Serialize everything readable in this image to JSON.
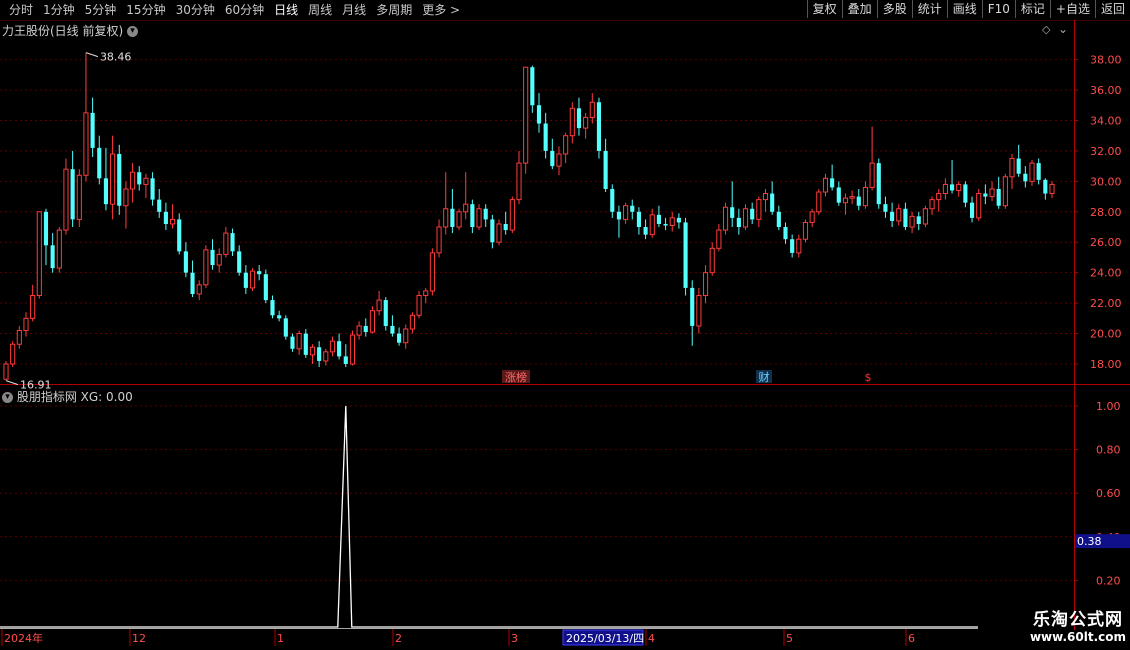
{
  "toolbar": {
    "periods": [
      "分时",
      "1分钟",
      "5分钟",
      "15分钟",
      "30分钟",
      "60分钟",
      "日线",
      "周线",
      "月线",
      "多周期",
      "更多"
    ],
    "active_period": "日线",
    "more_arrow": ">",
    "buttons": [
      "复权",
      "叠加",
      "多股",
      "统计",
      "画线",
      "F10",
      "标记",
      "+自选",
      "返回"
    ]
  },
  "main_chart": {
    "title": "力王股份(日线 前复权)",
    "max_marker": "38.46",
    "min_marker": "16.91",
    "y_ticks": [
      "38.00",
      "36.00",
      "34.00",
      "32.00",
      "30.00",
      "28.00",
      "26.00",
      "24.00",
      "22.00",
      "20.00",
      "18.00"
    ],
    "events": [
      {
        "label": "涨榜",
        "color": "#ff6a6a",
        "bg": "#5a1a1a"
      },
      {
        "label": "财",
        "color": "#6fd3ff",
        "bg": "#103050"
      },
      {
        "label": "$",
        "color": "#ff3030",
        "bg": "#000000"
      }
    ]
  },
  "indicator": {
    "title": "股朋指标网 XG: 0.00",
    "y_ticks": [
      "1.00",
      "0.80",
      "0.60",
      "0.40",
      "0.20"
    ],
    "current_value": "0.38"
  },
  "time_axis": {
    "labels": [
      "2024年",
      "12",
      "1",
      "2",
      "3",
      "4",
      "5",
      "6"
    ],
    "highlight": "2025/03/13/四"
  },
  "watermark": {
    "line1": "乐淘公式网",
    "line2": "www.60lt.com"
  },
  "colors": {
    "up": "#ff3b3b",
    "down": "#54ffff",
    "grid": "#5a0000",
    "axis": "#b00000"
  },
  "chart_data": {
    "type": "candlestick",
    "ylim": [
      16.5,
      39.5
    ],
    "ohlc": [
      [
        17.0,
        18.2,
        16.91,
        18.0
      ],
      [
        18.0,
        19.5,
        17.8,
        19.3
      ],
      [
        19.3,
        20.5,
        19.0,
        20.2
      ],
      [
        20.2,
        21.4,
        19.8,
        21.0
      ],
      [
        21.0,
        23.2,
        20.8,
        22.5
      ],
      [
        22.5,
        28.0,
        22.3,
        28.0
      ],
      [
        28.0,
        28.2,
        24.5,
        25.8
      ],
      [
        25.8,
        26.6,
        24.0,
        24.3
      ],
      [
        24.3,
        27.0,
        24.0,
        26.8
      ],
      [
        26.8,
        31.5,
        26.5,
        30.8
      ],
      [
        30.8,
        32.0,
        27.0,
        27.5
      ],
      [
        27.5,
        30.8,
        27.0,
        30.4
      ],
      [
        30.4,
        38.46,
        30.0,
        34.5
      ],
      [
        34.5,
        35.5,
        31.6,
        32.2
      ],
      [
        32.2,
        33.0,
        29.8,
        30.2
      ],
      [
        30.2,
        32.2,
        28.1,
        28.5
      ],
      [
        28.5,
        33.0,
        27.5,
        31.8
      ],
      [
        31.8,
        32.4,
        27.8,
        28.4
      ],
      [
        28.4,
        30.0,
        26.9,
        29.5
      ],
      [
        29.5,
        31.2,
        28.6,
        30.6
      ],
      [
        30.6,
        31.0,
        29.4,
        29.8
      ],
      [
        29.8,
        30.5,
        28.9,
        30.2
      ],
      [
        30.2,
        30.6,
        28.4,
        28.8
      ],
      [
        28.8,
        29.5,
        27.6,
        28.0
      ],
      [
        28.0,
        28.6,
        26.8,
        27.2
      ],
      [
        27.2,
        28.5,
        26.9,
        27.5
      ],
      [
        27.5,
        27.9,
        25.2,
        25.4
      ],
      [
        25.4,
        26.0,
        23.7,
        24.0
      ],
      [
        24.0,
        24.8,
        22.4,
        22.6
      ],
      [
        22.6,
        23.5,
        22.2,
        23.2
      ],
      [
        23.2,
        25.8,
        23.0,
        25.5
      ],
      [
        25.5,
        26.2,
        24.2,
        24.5
      ],
      [
        24.5,
        25.6,
        24.0,
        25.2
      ],
      [
        25.2,
        27.0,
        25.0,
        26.6
      ],
      [
        26.6,
        26.9,
        25.1,
        25.4
      ],
      [
        25.4,
        25.8,
        23.8,
        24.0
      ],
      [
        24.0,
        24.5,
        22.6,
        23.0
      ],
      [
        23.0,
        24.3,
        22.8,
        24.1
      ],
      [
        24.1,
        24.5,
        23.5,
        23.9
      ],
      [
        23.9,
        24.2,
        22.0,
        22.2
      ],
      [
        22.2,
        22.5,
        21.0,
        21.2
      ],
      [
        21.2,
        21.5,
        20.8,
        21.0
      ],
      [
        21.0,
        21.2,
        19.6,
        19.8
      ],
      [
        19.8,
        20.0,
        18.8,
        19.0
      ],
      [
        19.0,
        20.2,
        18.6,
        20.0
      ],
      [
        20.0,
        20.3,
        18.4,
        18.6
      ],
      [
        18.6,
        19.3,
        18.0,
        19.1
      ],
      [
        19.1,
        19.5,
        17.8,
        18.2
      ],
      [
        18.2,
        19.0,
        17.9,
        18.8
      ],
      [
        18.8,
        19.8,
        18.5,
        19.5
      ],
      [
        19.5,
        20.0,
        18.3,
        18.5
      ],
      [
        18.5,
        19.3,
        17.8,
        18.0
      ],
      [
        18.0,
        20.2,
        17.9,
        19.9
      ],
      [
        19.9,
        20.8,
        19.6,
        20.5
      ],
      [
        20.5,
        21.0,
        19.8,
        20.1
      ],
      [
        20.1,
        21.8,
        20.0,
        21.5
      ],
      [
        21.5,
        22.8,
        21.2,
        22.2
      ],
      [
        22.2,
        22.4,
        20.2,
        20.5
      ],
      [
        20.5,
        21.2,
        19.8,
        20.0
      ],
      [
        20.0,
        20.4,
        19.2,
        19.4
      ],
      [
        19.4,
        20.6,
        19.0,
        20.3
      ],
      [
        20.3,
        21.4,
        20.0,
        21.2
      ],
      [
        21.2,
        22.8,
        21.0,
        22.5
      ],
      [
        22.5,
        23.0,
        22.0,
        22.8
      ],
      [
        22.8,
        25.6,
        22.5,
        25.3
      ],
      [
        25.3,
        27.5,
        25.0,
        27.0
      ],
      [
        27.0,
        30.6,
        26.5,
        28.2
      ],
      [
        28.2,
        29.5,
        26.6,
        27.0
      ],
      [
        27.0,
        28.2,
        26.8,
        28.0
      ],
      [
        28.0,
        30.6,
        27.5,
        28.5
      ],
      [
        28.5,
        28.8,
        26.6,
        27.0
      ],
      [
        27.0,
        28.5,
        26.8,
        28.2
      ],
      [
        28.2,
        28.5,
        27.0,
        27.5
      ],
      [
        27.5,
        27.8,
        25.6,
        26.0
      ],
      [
        26.0,
        27.5,
        25.8,
        27.2
      ],
      [
        27.2,
        28.0,
        26.5,
        26.8
      ],
      [
        26.8,
        29.0,
        26.6,
        28.8
      ],
      [
        28.8,
        32.0,
        28.5,
        31.2
      ],
      [
        31.2,
        37.5,
        30.5,
        37.5
      ],
      [
        37.5,
        37.6,
        34.5,
        35.0
      ],
      [
        35.0,
        35.8,
        33.2,
        33.8
      ],
      [
        33.8,
        34.5,
        31.5,
        32.0
      ],
      [
        32.0,
        32.8,
        30.8,
        31.0
      ],
      [
        31.0,
        32.3,
        30.4,
        31.8
      ],
      [
        31.8,
        33.2,
        31.2,
        33.0
      ],
      [
        33.0,
        35.2,
        32.5,
        34.8
      ],
      [
        34.8,
        35.5,
        33.0,
        33.5
      ],
      [
        33.5,
        34.5,
        32.8,
        34.2
      ],
      [
        34.2,
        35.8,
        33.8,
        35.2
      ],
      [
        35.2,
        35.5,
        31.5,
        32.0
      ],
      [
        32.0,
        32.8,
        29.3,
        29.5
      ],
      [
        29.5,
        29.8,
        27.6,
        28.0
      ],
      [
        28.0,
        28.4,
        26.3,
        27.5
      ],
      [
        27.5,
        28.6,
        27.2,
        28.4
      ],
      [
        28.4,
        28.8,
        27.5,
        28.0
      ],
      [
        28.0,
        28.3,
        26.5,
        27.0
      ],
      [
        27.0,
        27.5,
        26.2,
        26.5
      ],
      [
        26.5,
        28.2,
        26.3,
        27.8
      ],
      [
        27.8,
        28.4,
        27.0,
        27.2
      ],
      [
        27.2,
        27.6,
        26.8,
        27.1
      ],
      [
        27.1,
        28.0,
        26.7,
        27.6
      ],
      [
        27.6,
        27.9,
        26.9,
        27.3
      ],
      [
        27.3,
        27.6,
        22.5,
        23.0
      ],
      [
        23.0,
        23.5,
        19.2,
        20.5
      ],
      [
        20.5,
        23.0,
        20.0,
        22.5
      ],
      [
        22.5,
        24.5,
        22.0,
        24.0
      ],
      [
        24.0,
        26.0,
        23.8,
        25.6
      ],
      [
        25.6,
        27.2,
        25.4,
        26.8
      ],
      [
        26.8,
        28.6,
        26.5,
        28.3
      ],
      [
        28.3,
        30.0,
        27.0,
        27.6
      ],
      [
        27.6,
        28.2,
        26.5,
        27.0
      ],
      [
        27.0,
        28.5,
        26.8,
        28.2
      ],
      [
        28.2,
        28.6,
        27.2,
        27.5
      ],
      [
        27.5,
        29.0,
        27.0,
        28.8
      ],
      [
        28.8,
        29.5,
        28.0,
        29.2
      ],
      [
        29.2,
        30.0,
        27.8,
        28.0
      ],
      [
        28.0,
        28.4,
        26.8,
        27.0
      ],
      [
        27.0,
        27.3,
        25.9,
        26.2
      ],
      [
        26.2,
        26.5,
        25.0,
        25.3
      ],
      [
        25.3,
        26.5,
        25.0,
        26.2
      ],
      [
        26.2,
        27.5,
        26.0,
        27.3
      ],
      [
        27.3,
        28.2,
        27.0,
        28.0
      ],
      [
        28.0,
        29.5,
        27.8,
        29.3
      ],
      [
        29.3,
        30.5,
        29.0,
        30.2
      ],
      [
        30.2,
        31.1,
        29.4,
        29.6
      ],
      [
        29.6,
        30.0,
        28.4,
        28.6
      ],
      [
        28.6,
        29.2,
        27.8,
        28.9
      ],
      [
        28.9,
        29.4,
        28.5,
        29.0
      ],
      [
        29.0,
        29.5,
        28.1,
        28.4
      ],
      [
        28.4,
        30.0,
        28.2,
        29.6
      ],
      [
        29.6,
        33.6,
        29.4,
        31.2
      ],
      [
        31.2,
        31.5,
        28.2,
        28.5
      ],
      [
        28.5,
        29.0,
        27.6,
        28.0
      ],
      [
        28.0,
        28.6,
        27.0,
        27.4
      ],
      [
        27.4,
        28.5,
        27.1,
        28.2
      ],
      [
        28.2,
        28.6,
        26.8,
        27.0
      ],
      [
        27.0,
        28.0,
        26.6,
        27.7
      ],
      [
        27.7,
        28.0,
        26.8,
        27.2
      ],
      [
        27.2,
        28.4,
        27.0,
        28.2
      ],
      [
        28.2,
        29.0,
        27.8,
        28.8
      ],
      [
        28.8,
        29.5,
        28.0,
        29.2
      ],
      [
        29.2,
        30.2,
        28.8,
        29.8
      ],
      [
        29.8,
        31.4,
        29.2,
        29.4
      ],
      [
        29.4,
        30.0,
        29.0,
        29.8
      ],
      [
        29.8,
        30.0,
        28.3,
        28.6
      ],
      [
        28.6,
        29.0,
        27.3,
        27.6
      ],
      [
        27.6,
        29.5,
        27.4,
        29.2
      ],
      [
        29.2,
        29.8,
        28.5,
        29.0
      ],
      [
        29.0,
        30.0,
        28.7,
        29.5
      ],
      [
        29.5,
        30.3,
        28.2,
        28.4
      ],
      [
        28.4,
        30.5,
        28.2,
        30.3
      ],
      [
        30.3,
        31.8,
        29.5,
        31.5
      ],
      [
        31.5,
        32.4,
        30.3,
        30.5
      ],
      [
        30.5,
        31.0,
        29.6,
        30.0
      ],
      [
        30.0,
        31.4,
        29.7,
        31.2
      ],
      [
        31.2,
        31.5,
        29.8,
        30.1
      ],
      [
        30.1,
        30.2,
        28.8,
        29.2
      ],
      [
        29.2,
        30.0,
        28.9,
        29.8
      ]
    ],
    "indicator_series": {
      "name": "XG",
      "spike_index": 51,
      "spike_value": 1.0,
      "last_value": 0.0
    }
  }
}
